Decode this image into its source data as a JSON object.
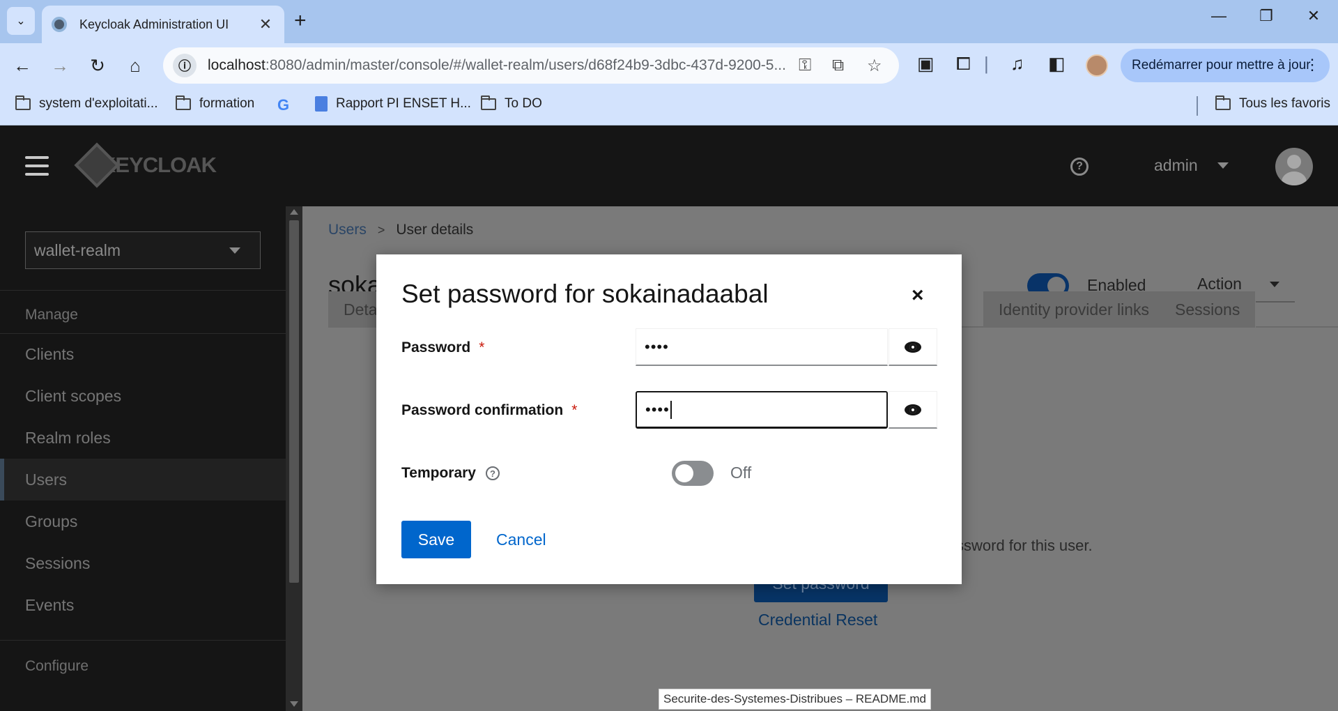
{
  "browser": {
    "tab_title": "Keycloak Administration UI",
    "tab_close": "✕",
    "new_tab": "+",
    "url_host": "localhost",
    "url_rest": ":8080/admin/master/console/#/wallet-realm/users/d68f24b9-3dbc-437d-9200-5...",
    "update_button": "Redémarrer pour mettre à jour",
    "bookmarks": [
      "system d'exploitati...",
      "formation",
      "Rapport PI ENSET H...",
      "To DO"
    ],
    "all_bookmarks": "Tous les favoris"
  },
  "header": {
    "logo_text": "KEYCLOAK",
    "user": "admin"
  },
  "sidebar": {
    "realm": "wallet-realm",
    "manage_label": "Manage",
    "items": [
      {
        "label": "Clients"
      },
      {
        "label": "Client scopes"
      },
      {
        "label": "Realm roles"
      },
      {
        "label": "Users"
      },
      {
        "label": "Groups"
      },
      {
        "label": "Sessions"
      },
      {
        "label": "Events"
      }
    ],
    "configure_label": "Configure"
  },
  "page": {
    "breadcrumb_users": "Users",
    "breadcrumb_sep": ">",
    "breadcrumb_current": "User details",
    "title_partial": "sokai",
    "enabled_label": "Enabled",
    "action_label": "Action",
    "tabs": [
      "Deta",
      "Identity provider links",
      "Sessions"
    ],
    "bg_text": "ssword for this user.",
    "bg_set_password": "Set password",
    "bg_credential_reset": "Credential Reset"
  },
  "status_tooltip": "Securite-des-Systemes-Distribues – README.md",
  "modal": {
    "title": "Set password for sokainadaabal",
    "close": "×",
    "password_label": "Password",
    "password_value": "••••",
    "confirm_label": "Password confirmation",
    "confirm_value": "••••",
    "required_mark": "*",
    "temporary_label": "Temporary",
    "temporary_state": "Off",
    "temporary_on": false,
    "save": "Save",
    "cancel": "Cancel"
  },
  "colors": {
    "primary": "#0066cc",
    "header_bg": "#151515",
    "required": "#c9190b"
  }
}
